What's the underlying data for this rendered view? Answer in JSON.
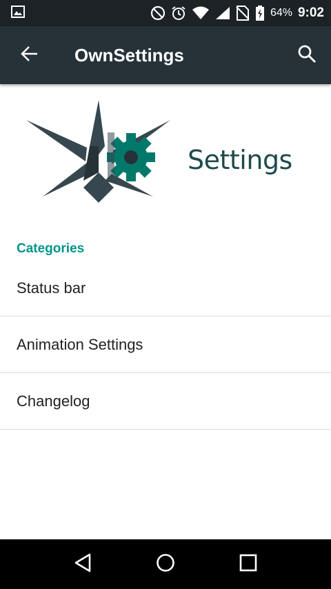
{
  "status_bar": {
    "battery_percent": "64%",
    "time": "9:02",
    "icons": [
      "image-icon",
      "do-not-disturb-icon",
      "alarm-icon",
      "wifi-icon",
      "signal-icon",
      "no-sim-icon",
      "battery-charging-icon"
    ]
  },
  "app_bar": {
    "title": "OwnSettings",
    "nav_icon": "back-arrow-icon",
    "action_icon": "search-icon"
  },
  "header": {
    "title": "Settings",
    "logo": "star-gear-logo"
  },
  "preferences": {
    "category": "Categories",
    "items": [
      {
        "label": "Status bar"
      },
      {
        "label": "Animation Settings"
      },
      {
        "label": "Changelog"
      }
    ]
  },
  "navigation_bar": {
    "buttons": [
      "back-triangle-icon",
      "home-circle-icon",
      "recents-square-icon"
    ]
  },
  "colors": {
    "status_bar": "#1c2226",
    "app_bar": "#263238",
    "accent": "#00968a",
    "title_text": "#1f4a4c"
  }
}
